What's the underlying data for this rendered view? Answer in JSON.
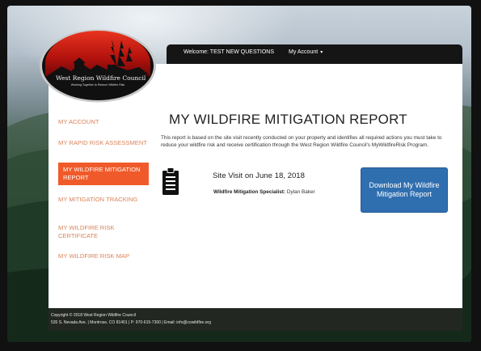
{
  "header": {
    "welcome": "Welcome: TEST NEW QUESTIONS",
    "account_menu": "My Account",
    "account_caret": "▾"
  },
  "logo": {
    "name": "West Region Wildfire Council",
    "tagline": "Working Together to Reduce Wildfire Risk"
  },
  "sidebar": {
    "items": [
      {
        "label": "MY ACCOUNT",
        "active": false
      },
      {
        "label": "MY RAPID RISK ASSESSMENT",
        "active": false
      },
      {
        "label": "MY WILDFIRE MITIGATION REPORT",
        "active": true
      },
      {
        "label": "MY MITIGATION TRACKING",
        "active": false
      },
      {
        "label": "MY WILDFIRE RISK CERTIFICATE",
        "active": false
      },
      {
        "label": "MY WILDFIRE RISK MAP",
        "active": false
      }
    ]
  },
  "main": {
    "title": "MY WILDFIRE MITIGATION REPORT",
    "intro": "This report is based on the site visit recently conducted on your property and identifies all required actions you must take to reduce your wildfire risk and receive certification through the West Region Wildfire Council's MyWildfireRisk Program.",
    "visit_title": "Site Visit on June 18, 2018",
    "specialist_label": "Wildfire Mitigation Specialist:",
    "specialist_name": "Dylan Baker",
    "download_label": "Download My Wildfire Mitigation Report",
    "icon": "clipboard-icon"
  },
  "footer": {
    "copyright": "Copyright © 2018 West Region Wildfire Council",
    "address": "535 S. Nevada Ave. | Montrose, CO 81401 | P: 970-615-7300 | Email: info@cowildfire.org"
  },
  "colors": {
    "accent": "#f05a2a",
    "nav_text": "#d9835a",
    "button": "#2f6fb0",
    "header_bar": "#151515"
  }
}
